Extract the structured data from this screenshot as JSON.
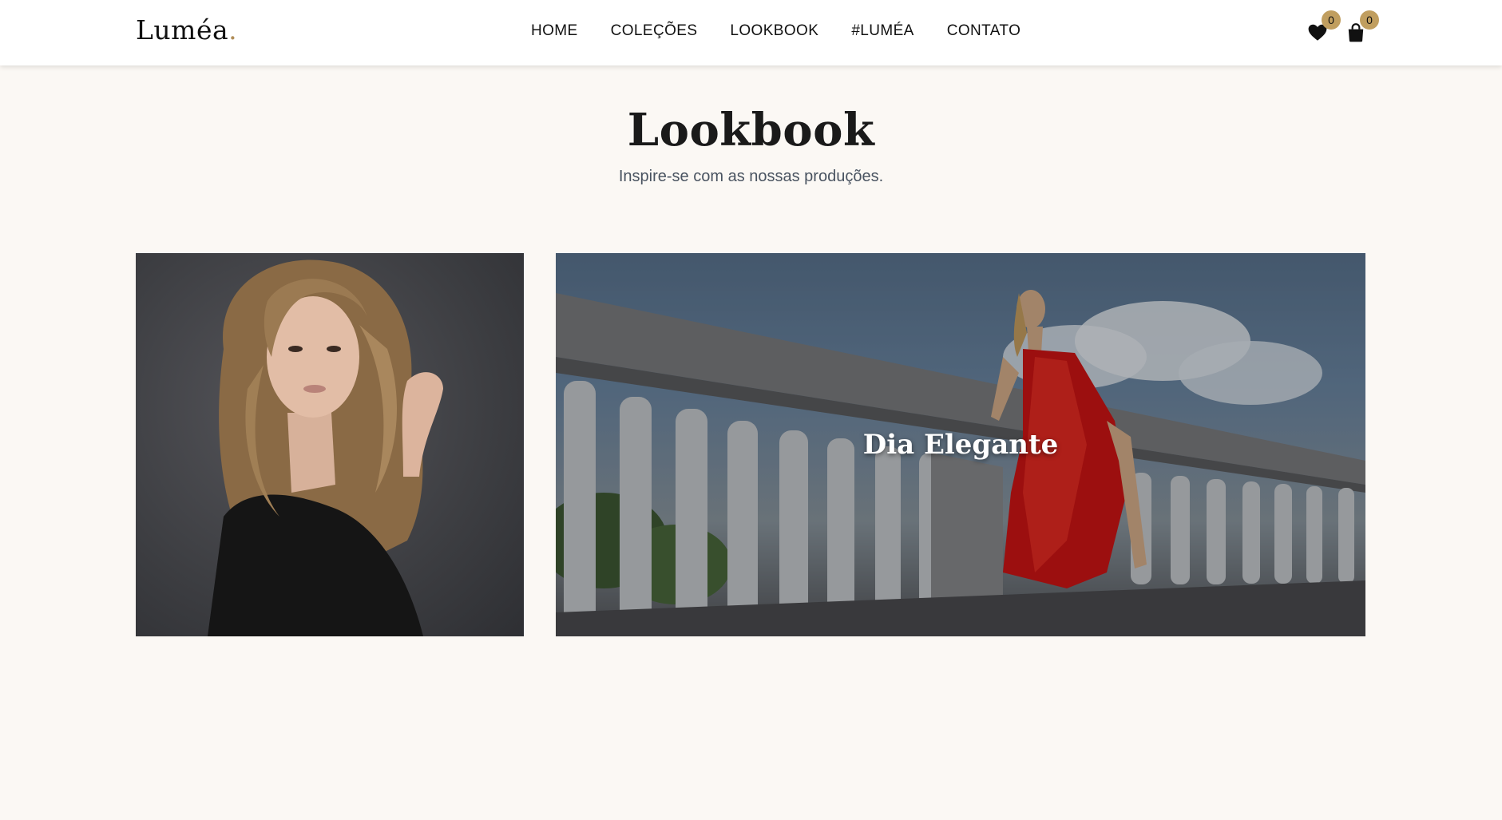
{
  "header": {
    "logo_text": "Luméa",
    "logo_dot": ".",
    "nav": [
      "HOME",
      "COLEÇÕES",
      "LOOKBOOK",
      "#LUMÉA",
      "CONTATO"
    ],
    "wishlist": {
      "icon": "heart-icon",
      "count": "0"
    },
    "cart": {
      "icon": "shopping-bag-icon",
      "count": "0"
    }
  },
  "page": {
    "title": "Lookbook",
    "subtitle": "Inspire-se com as nossas produções."
  },
  "lookbook": [
    {
      "caption": "",
      "image": "portrait-woman-black-top"
    },
    {
      "caption": "Dia Elegante",
      "image": "woman-red-dress-balustrade"
    }
  ],
  "colors": {
    "background": "#fbf8f4",
    "accent": "#c09e5f",
    "header_bg": "#ffffff",
    "subtitle": "#4a5461"
  }
}
